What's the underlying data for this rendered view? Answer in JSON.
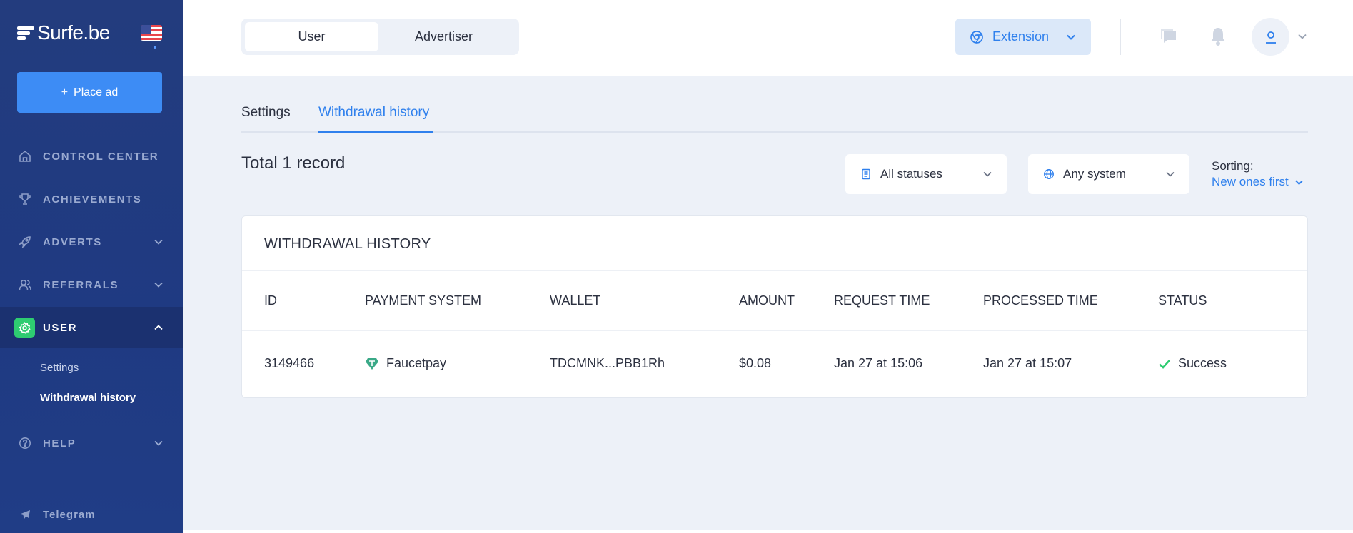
{
  "brand": {
    "name": "Surfe.be",
    "language_flag": "us-flag-icon"
  },
  "sidebar": {
    "place_ad_label": "Place ad",
    "items": [
      {
        "label": "CONTROL CENTER",
        "icon": "home-icon"
      },
      {
        "label": "ACHIEVEMENTS",
        "icon": "trophy-icon"
      },
      {
        "label": "ADVERTS",
        "icon": "rocket-icon"
      },
      {
        "label": "REFERRALS",
        "icon": "users-icon"
      },
      {
        "label": "USER",
        "icon": "gear-icon"
      },
      {
        "label": "HELP",
        "icon": "help-icon"
      },
      {
        "label": "Telegram",
        "icon": "telegram-icon"
      }
    ],
    "user_subitems": [
      "Settings",
      "Withdrawal history"
    ]
  },
  "topbar": {
    "mode_tabs": [
      "User",
      "Advertiser"
    ],
    "selected_mode": "User",
    "extension_label": "Extension"
  },
  "page_tabs": [
    "Settings",
    "Withdrawal history"
  ],
  "active_tab": "Withdrawal history",
  "total_text": "Total 1 record",
  "filters": {
    "status": "All statuses",
    "system": "Any system",
    "sorting_label": "Sorting:",
    "sorting_value": "New ones first"
  },
  "table": {
    "title": "WITHDRAWAL HISTORY",
    "columns": [
      "ID",
      "PAYMENT SYSTEM",
      "WALLET",
      "AMOUNT",
      "REQUEST TIME",
      "PROCESSED TIME",
      "STATUS"
    ],
    "rows": [
      {
        "id": "3149466",
        "payment_system": "Faucetpay",
        "wallet": "TDCMNK...PBB1Rh",
        "amount": "$0.08",
        "request_time": "Jan 27 at 15:06",
        "processed_time": "Jan 27 at 15:07",
        "status": "Success"
      }
    ]
  },
  "colors": {
    "accent": "#2f80ed",
    "sidebar": "#233c7e",
    "success": "#2ecc71"
  }
}
